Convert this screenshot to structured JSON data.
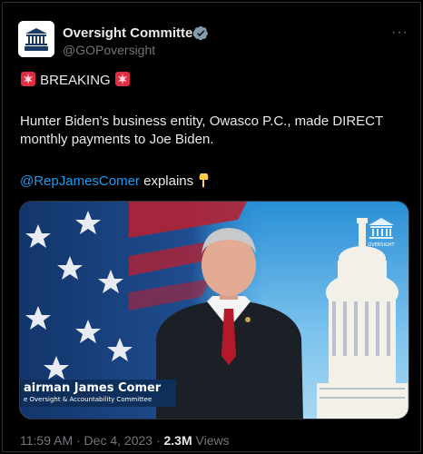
{
  "account": {
    "name": "Oversight Committee",
    "handle": "@GOPoversight"
  },
  "post": {
    "breaking": "BREAKING",
    "body_line1": "Hunter Biden’s business entity, Owasco P.C., made DIRECT",
    "body_line2": "monthly payments to Joe Biden.",
    "mention": "@RepJamesComer",
    "mention_suffix": " explains"
  },
  "video": {
    "lower_third_name": "airman James Comer",
    "lower_third_sub": "e Oversight & Accountability Committee",
    "watermark_text": "OVERSIGHT"
  },
  "meta": {
    "time": "11:59 AM · Dec 4, 2023 · ",
    "views_count": "2.3M",
    "views_label": " Views"
  },
  "colors": {
    "accent": "#1d9bf0",
    "muted": "#71767b",
    "text": "#e7e9ea",
    "background": "#000000"
  },
  "icons": [
    "avatar-logo",
    "verified-badge-icon",
    "more-options-icon",
    "siren-emoji-icon",
    "pointing-down-emoji-icon"
  ]
}
